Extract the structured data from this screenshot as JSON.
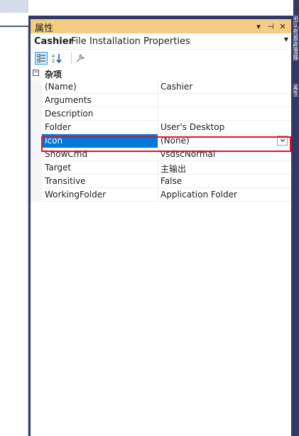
{
  "panel": {
    "title": "属性",
    "title_icons": [
      "dropdown-arrow-icon",
      "pin-icon",
      "close-icon"
    ],
    "object": {
      "name": "Cashier",
      "type": "File Installation Properties"
    },
    "toolbar": [
      "categorized-view-icon",
      "alphabetical-sort-icon",
      "property-pages-icon"
    ],
    "category": {
      "label": "杂项",
      "expander": "⊟"
    },
    "properties": [
      {
        "name": "(Name)",
        "value": "Cashier"
      },
      {
        "name": "Arguments",
        "value": ""
      },
      {
        "name": "Description",
        "value": ""
      },
      {
        "name": "Folder",
        "value": "User's Desktop"
      },
      {
        "name": "Icon",
        "value": "(None)"
      },
      {
        "name": "ShowCmd",
        "value": "vsdscNormal"
      },
      {
        "name": "Target",
        "value": "主输出"
      },
      {
        "name": "Transitive",
        "value": "False"
      },
      {
        "name": "WorkingFolder",
        "value": "Application Folder"
      }
    ],
    "selected_property": "Icon"
  },
  "right_dock": {
    "tabs": [
      "团队资源管理器",
      "属性"
    ]
  },
  "colors": {
    "frame": "#2f3a66",
    "titlebar": "#f5cc84",
    "selection": "#0078d7",
    "highlight": "#e81123"
  }
}
